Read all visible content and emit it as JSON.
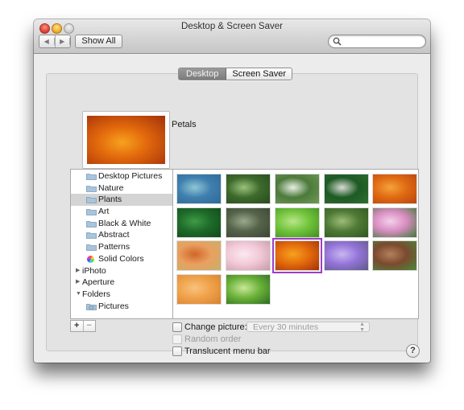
{
  "window": {
    "title": "Desktop & Screen Saver",
    "traffic_lights": [
      "close",
      "minimize",
      "zoom"
    ]
  },
  "toolbar": {
    "back_icon": "triangle-left-icon",
    "forward_icon": "triangle-right-icon",
    "back_glyph": "◀",
    "forward_glyph": "▶",
    "show_all_label": "Show All",
    "search_placeholder": "",
    "search_value": ""
  },
  "tabs": [
    {
      "label": "Desktop",
      "active": true
    },
    {
      "label": "Screen Saver",
      "active": false
    }
  ],
  "current_wallpaper": {
    "name": "Petals"
  },
  "sidebar": {
    "items": [
      {
        "label": "Desktop Pictures",
        "icon": "folder-icon",
        "indent": 1
      },
      {
        "label": "Nature",
        "icon": "folder-icon",
        "indent": 1
      },
      {
        "label": "Plants",
        "icon": "folder-icon",
        "indent": 1,
        "selected": true
      },
      {
        "label": "Art",
        "icon": "folder-icon",
        "indent": 1
      },
      {
        "label": "Black & White",
        "icon": "folder-icon",
        "indent": 1
      },
      {
        "label": "Abstract",
        "icon": "folder-icon",
        "indent": 1
      },
      {
        "label": "Patterns",
        "icon": "folder-icon",
        "indent": 1
      },
      {
        "label": "Solid Colors",
        "icon": "color-wheel-icon",
        "indent": 1
      },
      {
        "label": "iPhoto",
        "icon": "disclosure-right-icon",
        "indent": 0
      },
      {
        "label": "Aperture",
        "icon": "disclosure-right-icon",
        "indent": 0
      },
      {
        "label": "Folders",
        "icon": "disclosure-down-icon",
        "indent": 0
      },
      {
        "label": "Pictures",
        "icon": "pictures-folder-icon",
        "indent": 1
      }
    ],
    "add_label": "+",
    "remove_label": "−"
  },
  "thumbnails": [
    {
      "name": "agave",
      "colors": [
        "#3f7fae",
        "#8fc7d6",
        "#2d6a96"
      ]
    },
    {
      "name": "bamboo",
      "colors": [
        "#3d6a2c",
        "#9bc27a",
        "#2a4a1e"
      ]
    },
    {
      "name": "daisies",
      "colors": [
        "#4d7a3c",
        "#e9efe4",
        "#6f9a54"
      ]
    },
    {
      "name": "dandelion",
      "colors": [
        "#1d5a24",
        "#d9dcd5",
        "#2f6e31"
      ]
    },
    {
      "name": "autumn-leaves",
      "colors": [
        "#e06a12",
        "#f3a33a",
        "#b84410"
      ]
    },
    {
      "name": "grass",
      "colors": [
        "#1e6a2a",
        "#3f9b45",
        "#0f4a1a"
      ]
    },
    {
      "name": "meadow",
      "colors": [
        "#55634a",
        "#9aa88c",
        "#3c4533"
      ]
    },
    {
      "name": "green-spiral",
      "colors": [
        "#72c43c",
        "#b9e68a",
        "#3f8e1e"
      ]
    },
    {
      "name": "fern",
      "colors": [
        "#4f7a35",
        "#9cbd78",
        "#2f5520"
      ]
    },
    {
      "name": "lotus",
      "colors": [
        "#d78cc0",
        "#f4d0ea",
        "#3d7a35"
      ]
    },
    {
      "name": "maple-orange",
      "colors": [
        "#e9a060",
        "#d0662a",
        "#c6b06a"
      ]
    },
    {
      "name": "pink-flower",
      "colors": [
        "#f2c9d8",
        "#fbe8ef",
        "#c79aa8"
      ]
    },
    {
      "name": "petals",
      "colors": [
        "#e36a0c",
        "#f7a21e",
        "#a3300a"
      ],
      "selected": true
    },
    {
      "name": "purple-petals",
      "colors": [
        "#9474d8",
        "#c9b6f2",
        "#5f5a86"
      ]
    },
    {
      "name": "redwoods",
      "colors": [
        "#7a4a30",
        "#b38059",
        "#4a8a3a"
      ]
    },
    {
      "name": "tree-rings",
      "colors": [
        "#f0a24a",
        "#f7c27e",
        "#d78130"
      ]
    },
    {
      "name": "green-leaves",
      "colors": [
        "#6cb23a",
        "#c9e79a",
        "#2d6b1f"
      ]
    }
  ],
  "options": {
    "change_picture": {
      "label": "Change picture:",
      "checked": false
    },
    "interval": {
      "value": "Every 30 minutes",
      "enabled": false
    },
    "random_order": {
      "label": "Random order",
      "checked": false,
      "enabled": false
    },
    "translucent_menu_bar": {
      "label": "Translucent menu bar",
      "checked": false
    }
  },
  "help_label": "?"
}
